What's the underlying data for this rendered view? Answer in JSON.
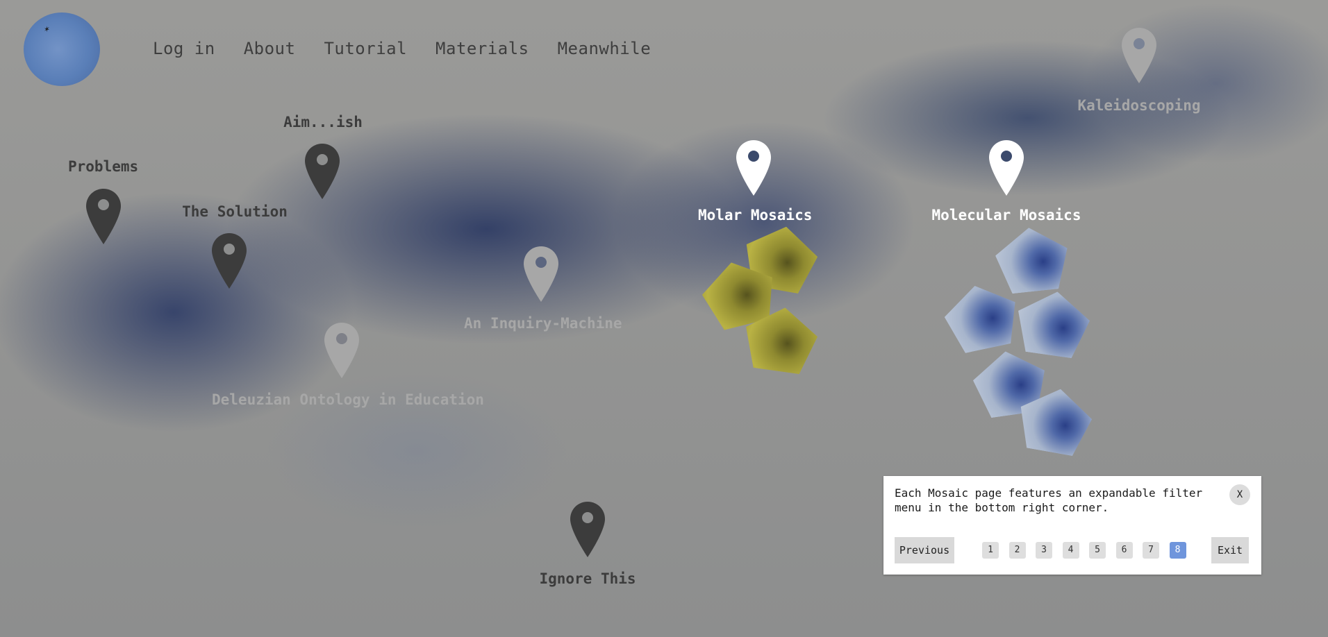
{
  "nav": {
    "items": [
      "Log in",
      "About",
      "Tutorial",
      "Materials",
      "Meanwhile"
    ]
  },
  "markers": {
    "problems": "Problems",
    "aimish": "Aim...ish",
    "solution": "The Solution",
    "deleuzian": "Deleuzian Ontology in Education",
    "inquiry": "An Inquiry-Machine",
    "molar": "Molar Mosaics",
    "molecular": "Molecular Mosaics",
    "kaleidoscoping": "Kaleidoscoping",
    "ignore": "Ignore This"
  },
  "tutorial": {
    "message": "Each Mosaic page features an expandable filter menu in the bottom right corner.",
    "close_label": "X",
    "previous_label": "Previous",
    "exit_label": "Exit",
    "pages": [
      "1",
      "2",
      "3",
      "4",
      "5",
      "6",
      "7",
      "8"
    ],
    "current_page": "8"
  },
  "colors": {
    "marker_dark": "#3c3c3c",
    "marker_light": "#a7a7a7",
    "marker_active": "#ffffff",
    "page_active": "#6f95dc"
  }
}
